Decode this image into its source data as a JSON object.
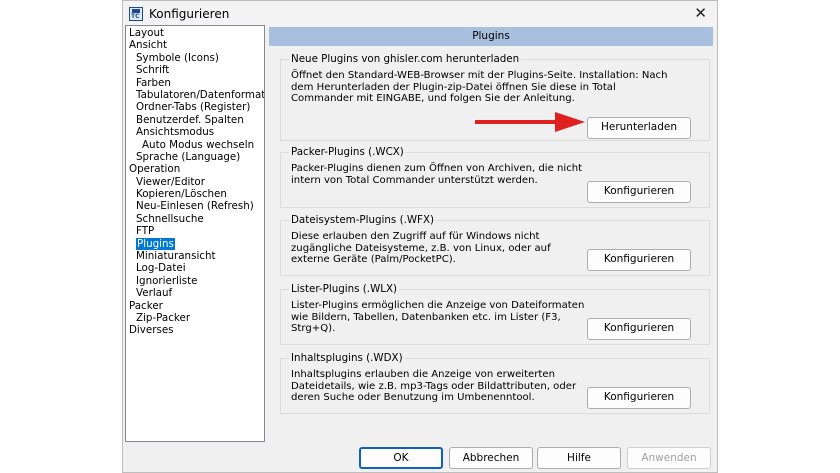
{
  "window": {
    "title": "Konfigurieren"
  },
  "tree": {
    "items": [
      {
        "label": "Layout",
        "level": 0
      },
      {
        "label": "Ansicht",
        "level": 0
      },
      {
        "label": "Symbole (Icons)",
        "level": 1
      },
      {
        "label": "Schrift",
        "level": 1
      },
      {
        "label": "Farben",
        "level": 1
      },
      {
        "label": "Tabulatoren/Datenformate",
        "level": 1
      },
      {
        "label": "Ordner-Tabs (Register)",
        "level": 1
      },
      {
        "label": "Benutzerdef. Spalten",
        "level": 1
      },
      {
        "label": "Ansichtsmodus",
        "level": 1
      },
      {
        "label": "Auto Modus wechseln",
        "level": 2
      },
      {
        "label": "Sprache (Language)",
        "level": 1
      },
      {
        "label": "Operation",
        "level": 0
      },
      {
        "label": "Viewer/Editor",
        "level": 1
      },
      {
        "label": "Kopieren/Löschen",
        "level": 1
      },
      {
        "label": "Neu-Einlesen (Refresh)",
        "level": 1
      },
      {
        "label": "Schnellsuche",
        "level": 1
      },
      {
        "label": "FTP",
        "level": 1
      },
      {
        "label": "Plugins",
        "level": 1,
        "selected": true
      },
      {
        "label": "Miniaturansicht",
        "level": 1
      },
      {
        "label": "Log-Datei",
        "level": 1
      },
      {
        "label": "Ignorierliste",
        "level": 1
      },
      {
        "label": "Verlauf",
        "level": 1
      },
      {
        "label": "Packer",
        "level": 0
      },
      {
        "label": "Zip-Packer",
        "level": 1
      },
      {
        "label": "Diverses",
        "level": 0
      }
    ]
  },
  "panel": {
    "title": "Plugins"
  },
  "groups": {
    "download": {
      "title": "Neue Plugins von ghisler.com herunterladen",
      "text": "Öffnet den Standard-WEB-Browser mit der Plugins-Seite. Installation: Nach dem Herunterladen der Plugin-zip-Datei öffnen Sie diese in Total Commander mit EINGABE, und folgen Sie der Anleitung.",
      "button": "Herunterladen"
    },
    "packer": {
      "title": "Packer-Plugins (.WCX)",
      "text": "Packer-Plugins dienen zum Öffnen von Archiven, die nicht intern von Total Commander unterstützt werden.",
      "button": "Konfigurieren"
    },
    "filesystem": {
      "title": "Dateisystem-Plugins (.WFX)",
      "text": "Diese erlauben den Zugriff auf für Windows nicht zugängliche Dateisysteme, z.B. von Linux, oder auf externe Geräte (Palm/PocketPC).",
      "button": "Konfigurieren"
    },
    "lister": {
      "title": "Lister-Plugins (.WLX)",
      "text": "Lister-Plugins ermöglichen die Anzeige von Dateiformaten wie Bildern, Tabellen, Datenbanken etc. im Lister (F3, Strg+Q).",
      "button": "Konfigurieren"
    },
    "content": {
      "title": "Inhaltsplugins (.WDX)",
      "text": "Inhaltsplugins erlauben die Anzeige von erweiterten Dateidetails, wie z.B. mp3-Tags oder Bildattributen, oder deren Suche oder Benutzung im Umbenenntool.",
      "button": "Konfigurieren"
    }
  },
  "footer": {
    "ok": "OK",
    "cancel": "Abbrechen",
    "help": "Hilfe",
    "apply": "Anwenden"
  },
  "colors": {
    "selection": "#0078d7",
    "header": "#a8bfdd",
    "arrow": "#e02020"
  }
}
